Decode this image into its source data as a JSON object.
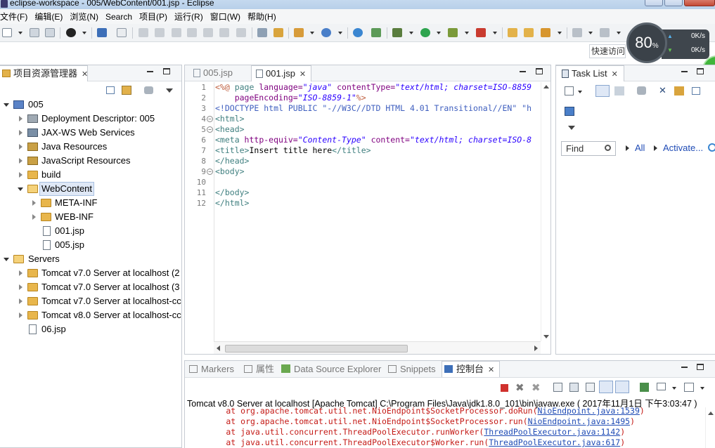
{
  "window": {
    "title": "eclipse-workspace - 005/WebContent/001.jsp - Eclipse"
  },
  "menu": [
    "文件(F)",
    "编辑(E)",
    "浏览(N)",
    "Search",
    "项目(P)",
    "运行(R)",
    "窗口(W)",
    "帮助(H)"
  ],
  "speed_widget": {
    "percent": "80",
    "percent_unit": "%",
    "up_rate": "0K/s",
    "down_rate": "0K/s",
    "small_badge": "80"
  },
  "quick_access": {
    "label": "快速访问"
  },
  "explorer": {
    "tab_label": "项目资源管理器",
    "tree": [
      {
        "label": "005"
      },
      {
        "label": "Deployment Descriptor: 005"
      },
      {
        "label": "JAX-WS Web Services"
      },
      {
        "label": "Java Resources"
      },
      {
        "label": "JavaScript Resources"
      },
      {
        "label": "build"
      },
      {
        "label": "WebContent"
      },
      {
        "label": "META-INF"
      },
      {
        "label": "WEB-INF"
      },
      {
        "label": "001.jsp"
      },
      {
        "label": "005.jsp"
      },
      {
        "label": "Servers"
      },
      {
        "label": "Tomcat v7.0 Server at localhost (2"
      },
      {
        "label": "Tomcat v7.0 Server at localhost (3"
      },
      {
        "label": "Tomcat v7.0 Server at localhost-cc"
      },
      {
        "label": "Tomcat v8.0 Server at localhost-cc"
      },
      {
        "label": "06.jsp"
      }
    ]
  },
  "editor": {
    "tabs": [
      {
        "label": "005.jsp"
      },
      {
        "label": "001.jsp"
      }
    ],
    "line_numbers": [
      "1",
      "2",
      "3",
      "4",
      "5",
      "6",
      "7",
      "8",
      "9",
      "10",
      "11",
      "12"
    ],
    "lines": [
      [
        {
          "t": "<%@ ",
          "c": "k-jsp"
        },
        {
          "t": "page ",
          "c": "k-tag"
        },
        {
          "t": "language=",
          "c": "k-attr"
        },
        {
          "t": "\"java\"",
          "c": "k-val"
        },
        {
          "t": " contentType=",
          "c": "k-attr"
        },
        {
          "t": "\"text/html; charset=ISO-8859",
          "c": "k-val"
        }
      ],
      [
        {
          "t": "    pageEncoding=",
          "c": "k-attr"
        },
        {
          "t": "\"ISO-8859-1\"",
          "c": "k-val"
        },
        {
          "t": "%>",
          "c": "k-jsp"
        }
      ],
      [
        {
          "t": "<!DOCTYPE html PUBLIC \"-//W3C//DTD HTML 4.01 Transitional//EN\" \"h",
          "c": "k-doc"
        }
      ],
      [
        {
          "t": "<html>",
          "c": "k-tag"
        }
      ],
      [
        {
          "t": "<head>",
          "c": "k-tag"
        }
      ],
      [
        {
          "t": "<meta ",
          "c": "k-tag"
        },
        {
          "t": "http-equiv=",
          "c": "k-attr"
        },
        {
          "t": "\"Content-Type\"",
          "c": "k-val"
        },
        {
          "t": " content=",
          "c": "k-attr"
        },
        {
          "t": "\"text/html; charset=ISO-8",
          "c": "k-val"
        }
      ],
      [
        {
          "t": "<title>",
          "c": "k-tag"
        },
        {
          "t": "Insert title here",
          "c": "k-text"
        },
        {
          "t": "</title>",
          "c": "k-tag"
        }
      ],
      [
        {
          "t": "</head>",
          "c": "k-tag"
        }
      ],
      [
        {
          "t": "<body>",
          "c": "k-tag"
        }
      ],
      [
        {
          "t": "",
          "c": "k-text"
        }
      ],
      [
        {
          "t": "</body>",
          "c": "k-tag"
        }
      ],
      [
        {
          "t": "</html>",
          "c": "k-tag"
        }
      ]
    ]
  },
  "tasklist": {
    "tab_label": "Task List",
    "find_placeholder": "Find",
    "all_label": "All",
    "activate_label": "Activate..."
  },
  "bottom": {
    "tabs": [
      {
        "label": "Markers"
      },
      {
        "label": "属性"
      },
      {
        "label": "Data Source Explorer"
      },
      {
        "label": "Snippets"
      },
      {
        "label": "控制台"
      }
    ],
    "console_header": "Tomcat v8.0 Server at localhost [Apache Tomcat] C:\\Program Files\\Java\\jdk1.8.0_101\\bin\\javaw.exe ( 2017年11月1日 下午3:03:47 )",
    "console_lines": [
      {
        "text": "        at org.apache.tomcat.util.net.NioEndpoint$SocketProcessor.doRun(",
        "link": "NioEndpoint.java:1539",
        "tail": ")"
      },
      {
        "text": "        at org.apache.tomcat.util.net.NioEndpoint$SocketProcessor.run(",
        "link": "NioEndpoint.java:1495",
        "tail": ")"
      },
      {
        "text": "        at java.util.concurrent.ThreadPoolExecutor.runWorker(",
        "link": "ThreadPoolExecutor.java:1142",
        "tail": ")"
      },
      {
        "text": "        at java.util.concurrent.ThreadPoolExecutor$Worker.run(",
        "link": "ThreadPoolExecutor.java:617",
        "tail": ")"
      }
    ]
  }
}
